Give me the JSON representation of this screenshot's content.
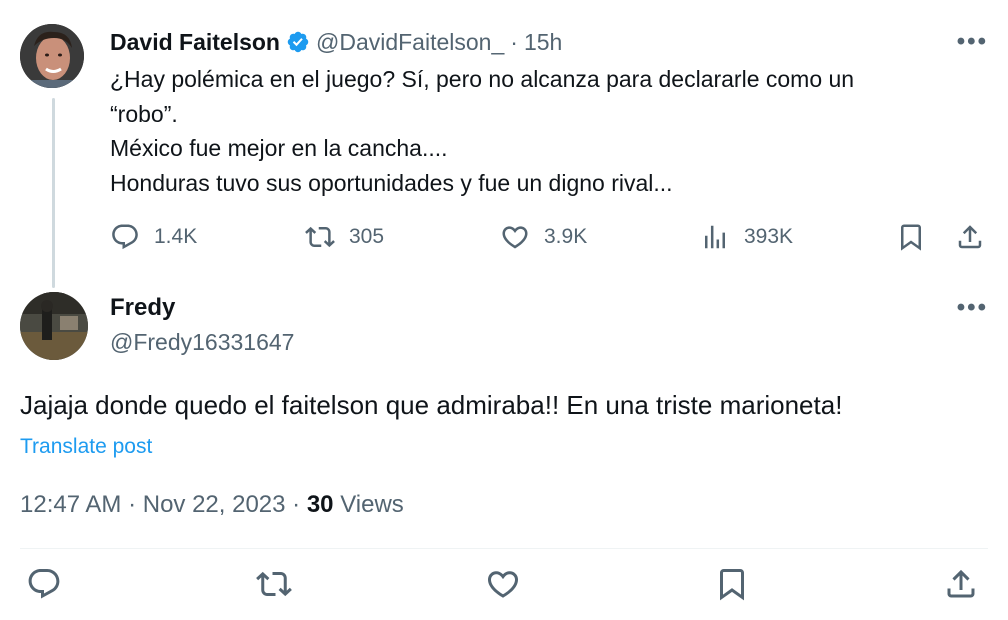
{
  "quoted_tweet": {
    "author_name": "David Faitelson",
    "author_handle": "@DavidFaitelson_",
    "separator": "·",
    "time_ago": "15h",
    "more_label": "•••",
    "text_lines": [
      "¿Hay polémica en el juego? Sí, pero no alcanza para declararle como un",
      "“robo”.",
      "México fue mejor en la cancha....",
      "Honduras tuvo sus oportunidades y fue un digno rival..."
    ],
    "actions": {
      "replies": "1.4K",
      "reposts": "305",
      "likes": "3.9K",
      "views": "393K"
    }
  },
  "reply_tweet": {
    "author_name": "Fredy",
    "author_handle": "@Fredy16331647",
    "more_label": "•••",
    "text": "Jajaja donde quedo el faitelson que admiraba!! En una triste marioneta!",
    "translate_label": "Translate post",
    "timestamp": "12:47 AM · Nov 22, 2023 · ",
    "views_count": "30",
    "views_label": " Views"
  },
  "colors": {
    "text_primary": "#0f1419",
    "text_secondary": "#536471",
    "accent": "#1d9bf0",
    "verified": "#1d9bf0",
    "thread_line": "#cfd9de"
  }
}
